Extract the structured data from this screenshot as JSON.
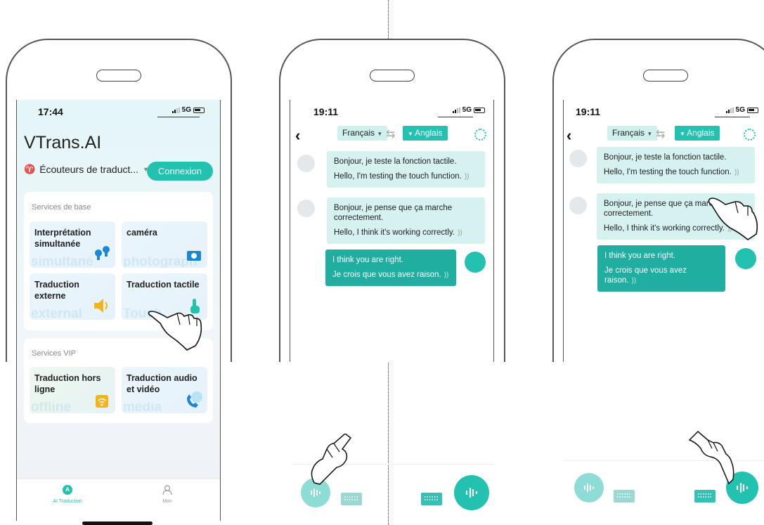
{
  "phone1": {
    "status_time": "17:44",
    "status_network": "5G",
    "app_title": "VTrans.AI",
    "device_label": "Écouteurs de traduct...",
    "connect_button": "Connexion",
    "basic_services": {
      "title": "Services de base",
      "tiles": [
        {
          "label": "Interprétation simultanée",
          "ghost": "simultané",
          "icon": "earbuds-icon"
        },
        {
          "label": "caméra",
          "ghost": "photograph",
          "icon": "camera-icon"
        },
        {
          "label": "Traduction externe",
          "ghost": "external",
          "icon": "speaker-icon"
        },
        {
          "label": "Traduction tactile",
          "ghost": "Touch",
          "icon": "touch-icon"
        }
      ]
    },
    "vip_services": {
      "title": "Services VIP",
      "tiles": [
        {
          "label": "Traduction hors ligne",
          "ghost": "offline",
          "icon": "offline-wifi-icon"
        },
        {
          "label": "Traduction audio et vidéo",
          "ghost": "media",
          "icon": "phone-call-icon"
        }
      ]
    },
    "nav": [
      {
        "label": "AI Traduction",
        "icon": "ai-translate-icon",
        "active": true
      },
      {
        "label": "Mon",
        "icon": "user-icon",
        "active": false
      }
    ]
  },
  "chat": {
    "status_time": "19:11",
    "status_network": "5G",
    "lang_left": "Français",
    "lang_right": "Anglais",
    "messages": [
      {
        "src": "Bonjour, je teste la fonction tactile.",
        "tr": "Hello, I'm testing the touch function.",
        "side": "left"
      },
      {
        "src": "Bonjour, je pense que ça marche correctement.",
        "tr": "Hello, I think it's working correctly.",
        "side": "left"
      },
      {
        "src": "I think you are right.",
        "tr": "Je crois que vous avez raison.",
        "side": "right"
      }
    ]
  },
  "colors": {
    "accent": "#22c1b0",
    "bubble": "#d6f2f0",
    "mine": "#1fae9f"
  }
}
